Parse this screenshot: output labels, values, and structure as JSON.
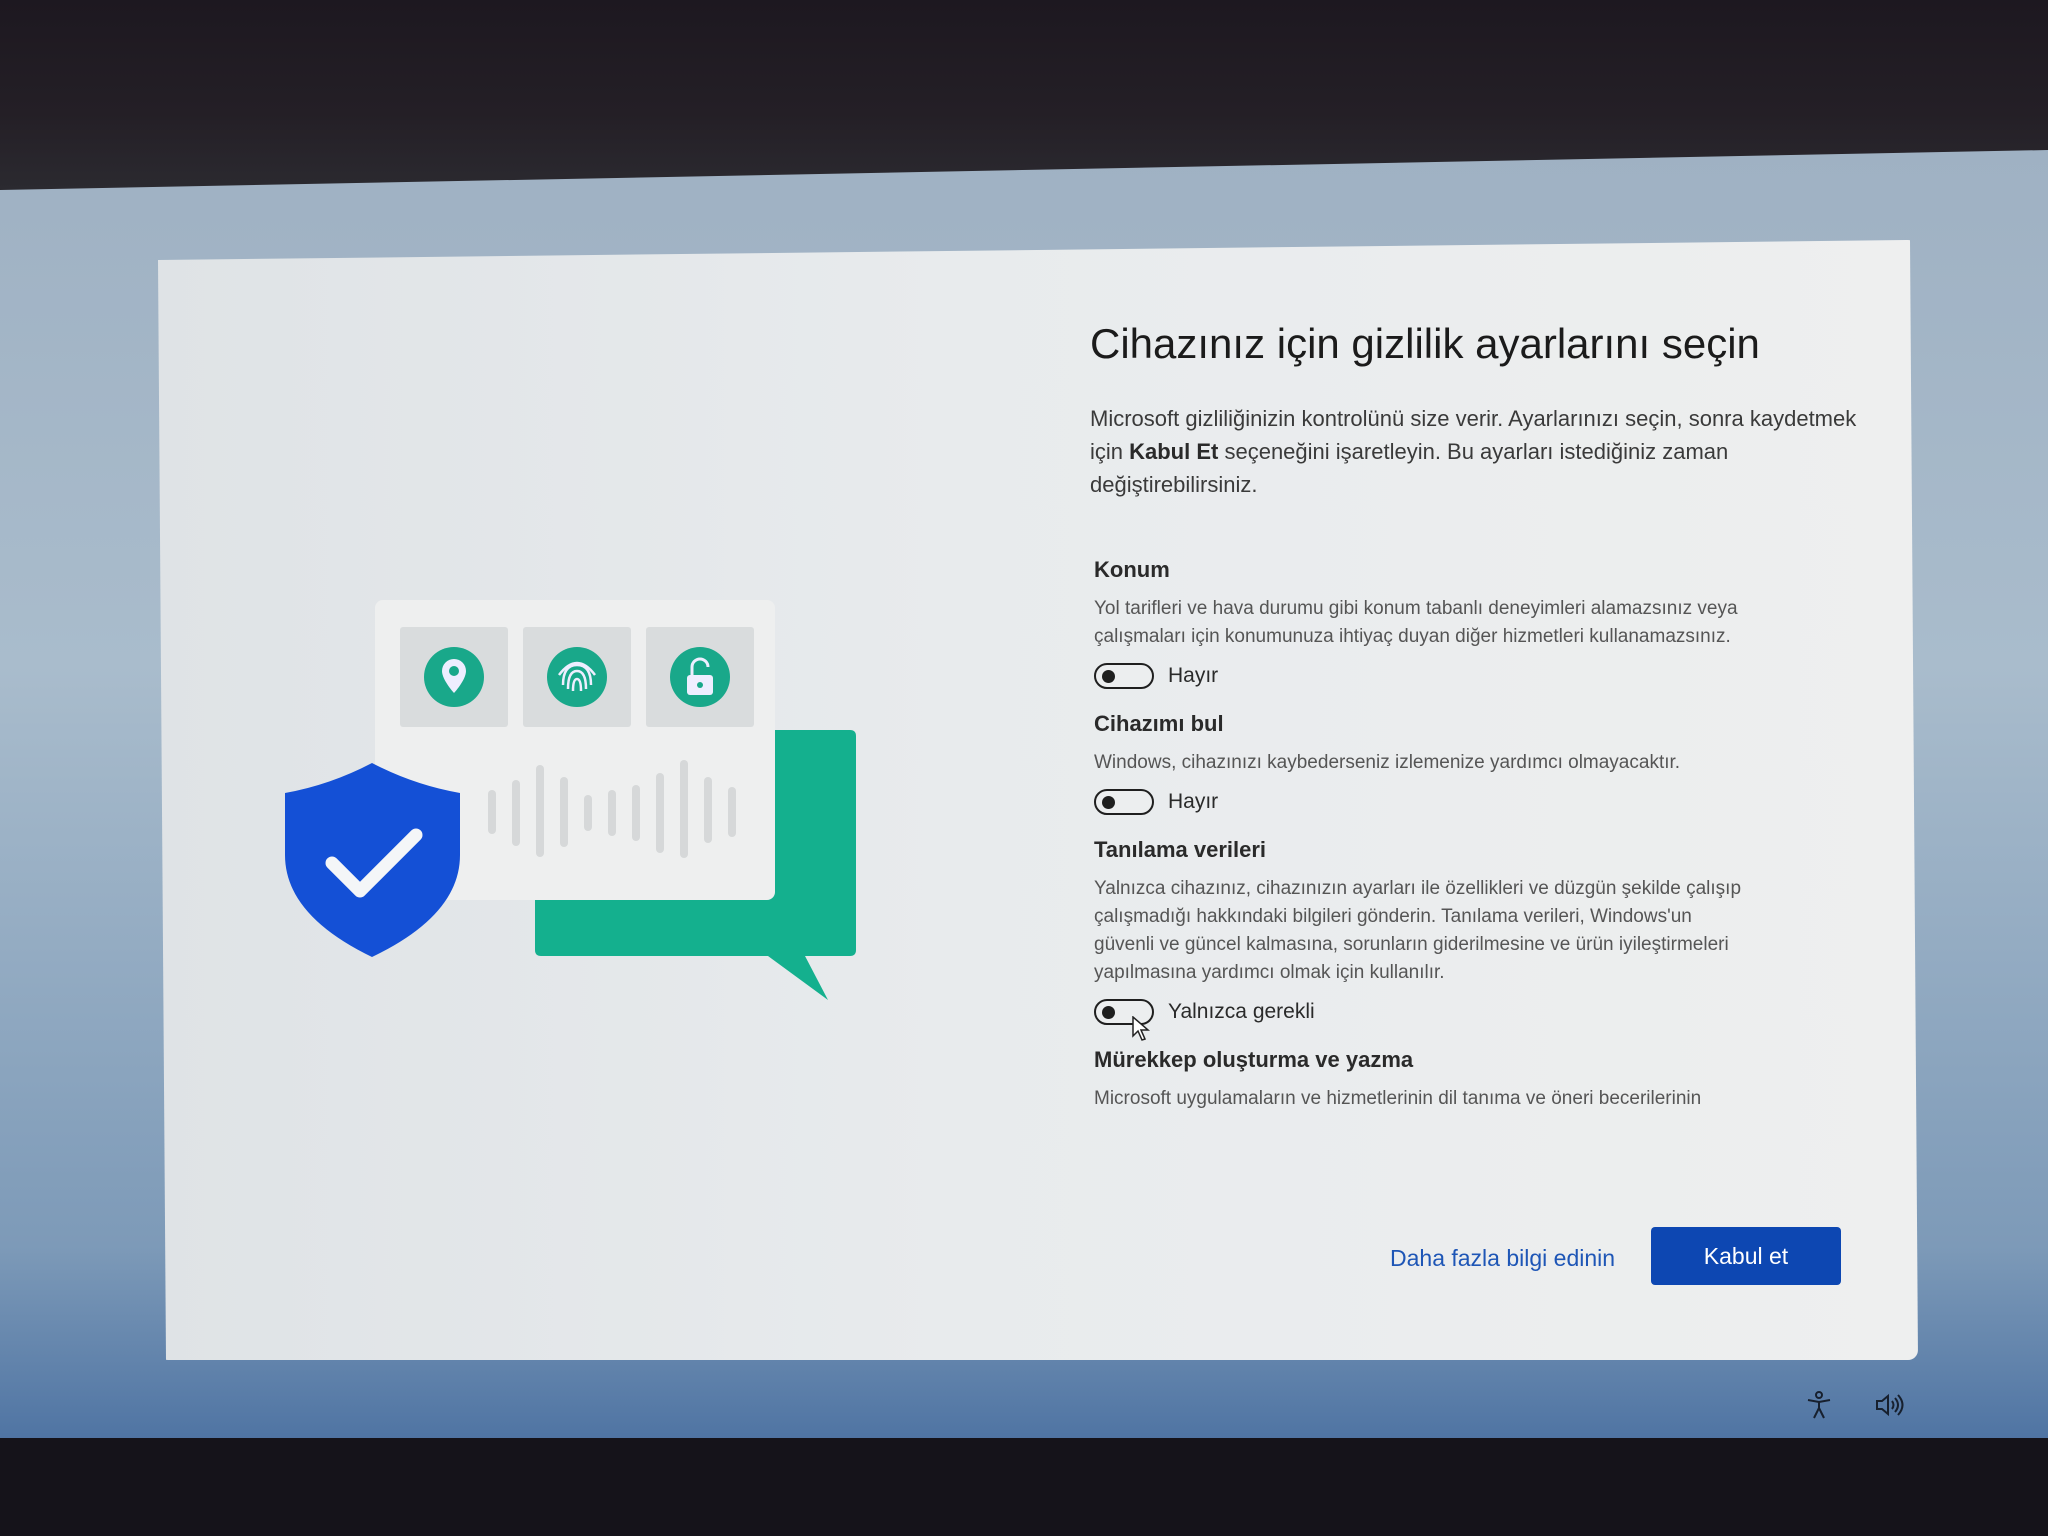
{
  "header": {
    "title": "Cihazınız için gizlilik ayarlarını seçin",
    "intro_part1": "Microsoft gizliliğinizin kontrolünü size verir. Ayarlarınızı seçin, sonra kaydetmek için ",
    "intro_bold": "Kabul Et",
    "intro_part2": " seçeneğini işaretleyin. Bu ayarları istediğiniz zaman değiştirebilirsiniz."
  },
  "settings": [
    {
      "title": "Konum",
      "description": "Yol tarifleri ve hava durumu gibi konum tabanlı deneyimleri alamazsınız veya çalışmaları için konumunuza ihtiyaç duyan diğer hizmetleri kullanamazsınız.",
      "toggle_state": "off",
      "toggle_label": "Hayır"
    },
    {
      "title": "Cihazımı bul",
      "description": "Windows, cihazınızı kaybederseniz izlemenize yardımcı olmayacaktır.",
      "toggle_state": "off",
      "toggle_label": "Hayır"
    },
    {
      "title": "Tanılama verileri",
      "description": "Yalnızca cihazınız, cihazınızın ayarları ile özellikleri ve düzgün şekilde çalışıp çalışmadığı hakkındaki bilgileri gönderin. Tanılama verileri, Windows'un güvenli ve güncel kalmasına, sorunların giderilmesine ve ürün iyileştirmeleri yapılmasına yardımcı olmak için kullanılır.",
      "toggle_state": "off",
      "toggle_label": "Yalnızca gerekli"
    },
    {
      "title": "Mürekkep oluşturma ve yazma",
      "description": "Microsoft uygulamaların ve hizmetlerinin dil tanıma ve öneri becerilerinin"
    }
  ],
  "footer": {
    "learn_more": "Daha fazla bilgi edinin",
    "accept": "Kabul et"
  },
  "tray": {
    "accessibility_icon": "accessibility-icon",
    "volume_icon": "volume-icon"
  },
  "colors": {
    "accent": "#0d47b2",
    "link": "#1e56b6",
    "teal": "#14b08e",
    "shield": "#1450d6"
  }
}
